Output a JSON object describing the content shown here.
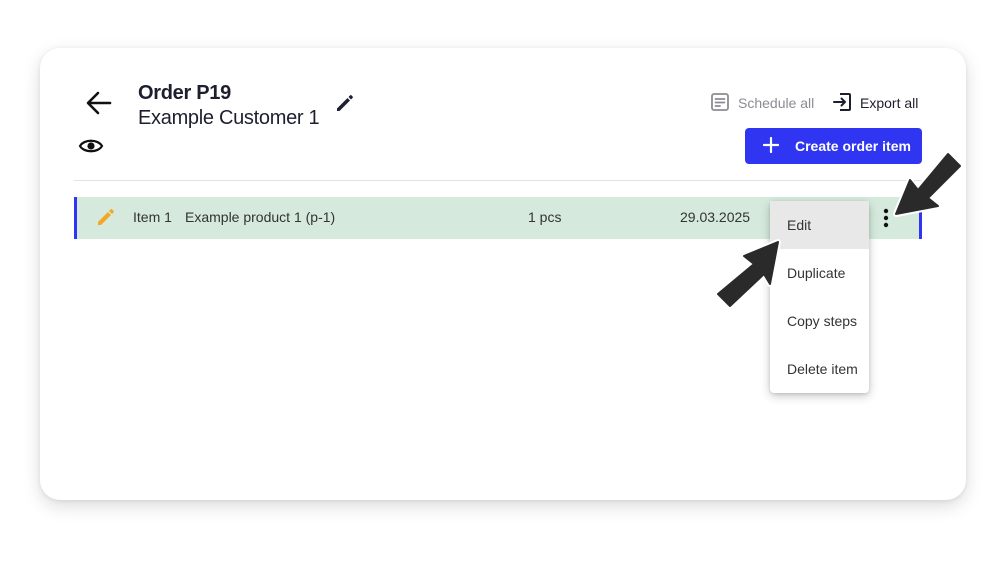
{
  "order": {
    "title": "Order P19",
    "customer": "Example Customer 1"
  },
  "toolbar": {
    "schedule_all": "Schedule all",
    "export_all": "Export all",
    "create_order_item": "Create order item"
  },
  "items": [
    {
      "label": "Item 1",
      "product": "Example product 1 (p-1)",
      "quantity": "1 pcs",
      "date": "29.03.2025"
    }
  ],
  "context_menu": {
    "items": [
      "Edit",
      "Duplicate",
      "Copy steps",
      "Delete item"
    ],
    "highlighted": "Edit"
  },
  "colors": {
    "accent": "#2f35f0",
    "row_background": "#d5eadd",
    "pencil": "#f5a623"
  }
}
